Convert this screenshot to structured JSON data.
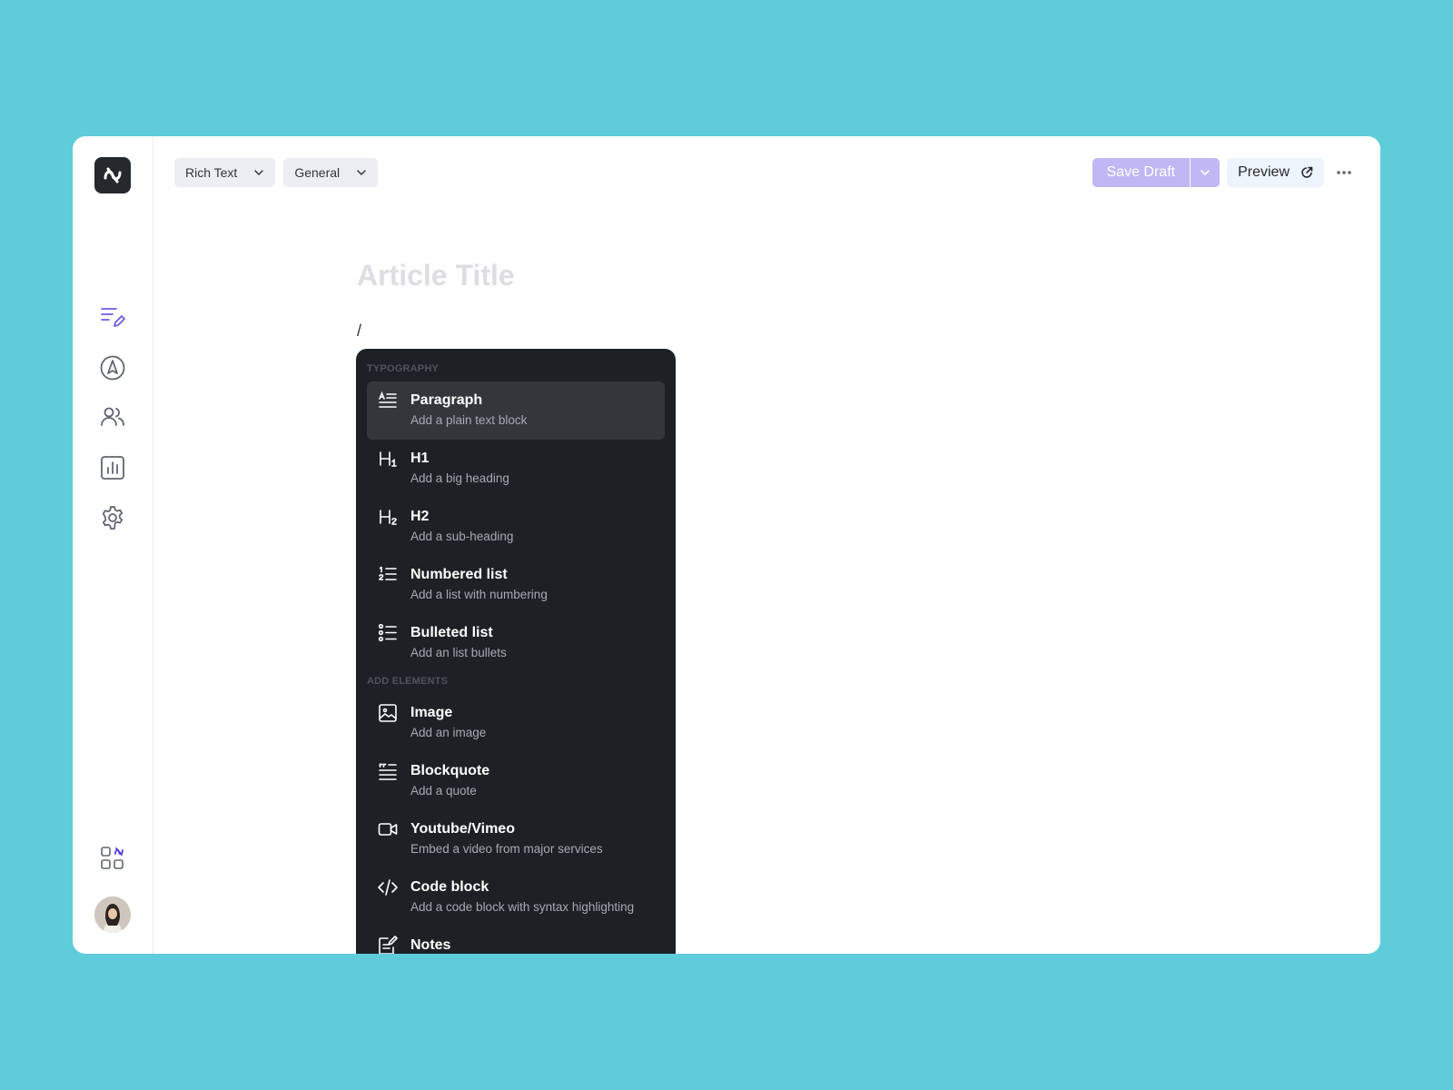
{
  "toolbar": {
    "type_dropdown": "Rich Text",
    "category_dropdown": "General",
    "save_label": "Save Draft",
    "preview_label": "Preview"
  },
  "editor": {
    "title_placeholder": "Article Title",
    "command_text": "/"
  },
  "sidebar": {
    "items": [
      {
        "icon": "edit-article-icon",
        "active": true
      },
      {
        "icon": "compass-icon"
      },
      {
        "icon": "users-icon"
      },
      {
        "icon": "analytics-icon"
      },
      {
        "icon": "gear-icon"
      }
    ],
    "accent": "#6c5ce7"
  },
  "menu": {
    "sections": {
      "typography": "TYPOGRAPHY",
      "elements": "ADD ELEMENTS"
    },
    "items": [
      {
        "title": "Paragraph",
        "desc": "Add a plain text block",
        "icon": "paragraph-icon"
      },
      {
        "title": "H1",
        "desc": "Add a big heading",
        "icon": "heading1-icon"
      },
      {
        "title": "H2",
        "desc": "Add a sub-heading",
        "icon": "heading2-icon"
      },
      {
        "title": "Numbered list",
        "desc": "Add a list with numbering",
        "icon": "numbered-list-icon"
      },
      {
        "title": "Bulleted list",
        "desc": "Add an list bullets",
        "icon": "bulleted-list-icon"
      },
      {
        "title": "Image",
        "desc": "Add an image",
        "icon": "image-icon"
      },
      {
        "title": "Blockquote",
        "desc": "Add a quote",
        "icon": "blockquote-icon"
      },
      {
        "title": "Youtube/Vimeo",
        "desc": "Embed a video from major services",
        "icon": "video-icon"
      },
      {
        "title": "Code block",
        "desc": "Add a code block with syntax highlighting",
        "icon": "code-icon"
      },
      {
        "title": "Notes",
        "desc": "",
        "icon": "notes-icon"
      }
    ]
  }
}
